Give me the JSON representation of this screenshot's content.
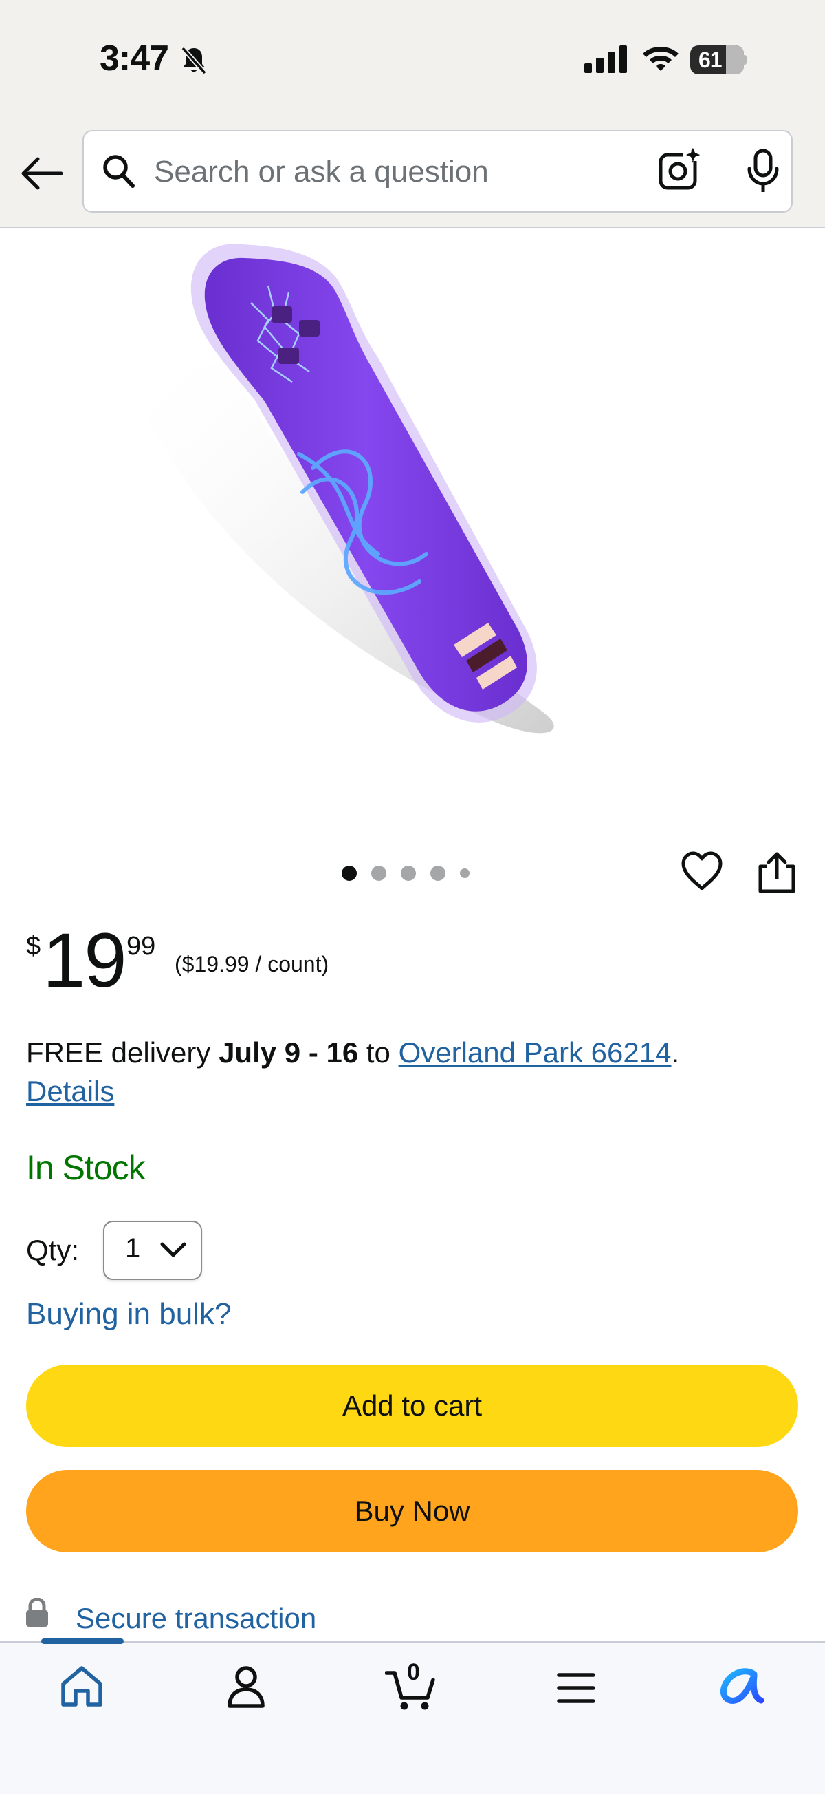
{
  "status_bar": {
    "time": "3:47",
    "battery": "61"
  },
  "search": {
    "placeholder": "Search or ask a question"
  },
  "carousel": {
    "total": 5,
    "active": 1
  },
  "price": {
    "currency": "$",
    "whole": "19",
    "fraction": "99",
    "unit_price": "($19.99 / count)"
  },
  "delivery": {
    "prefix": "FREE delivery",
    "dates": "July 9 - 16",
    "to": "to",
    "location": "Overland Park 66214",
    "period": ".",
    "details": "Details"
  },
  "stock": "In Stock",
  "quantity": {
    "label": "Qty:",
    "value": "1"
  },
  "bulk": "Buying in bulk?",
  "buttons": {
    "add_to_cart": "Add to cart",
    "buy_now": "Buy Now"
  },
  "secure": "Secure transaction",
  "nav": {
    "cart_count": "0"
  },
  "colors": {
    "add_to_cart": "#ffd814",
    "buy_now": "#ffa41c",
    "link": "#2162a1",
    "in_stock": "#007600",
    "product": "#7b3fe0"
  }
}
